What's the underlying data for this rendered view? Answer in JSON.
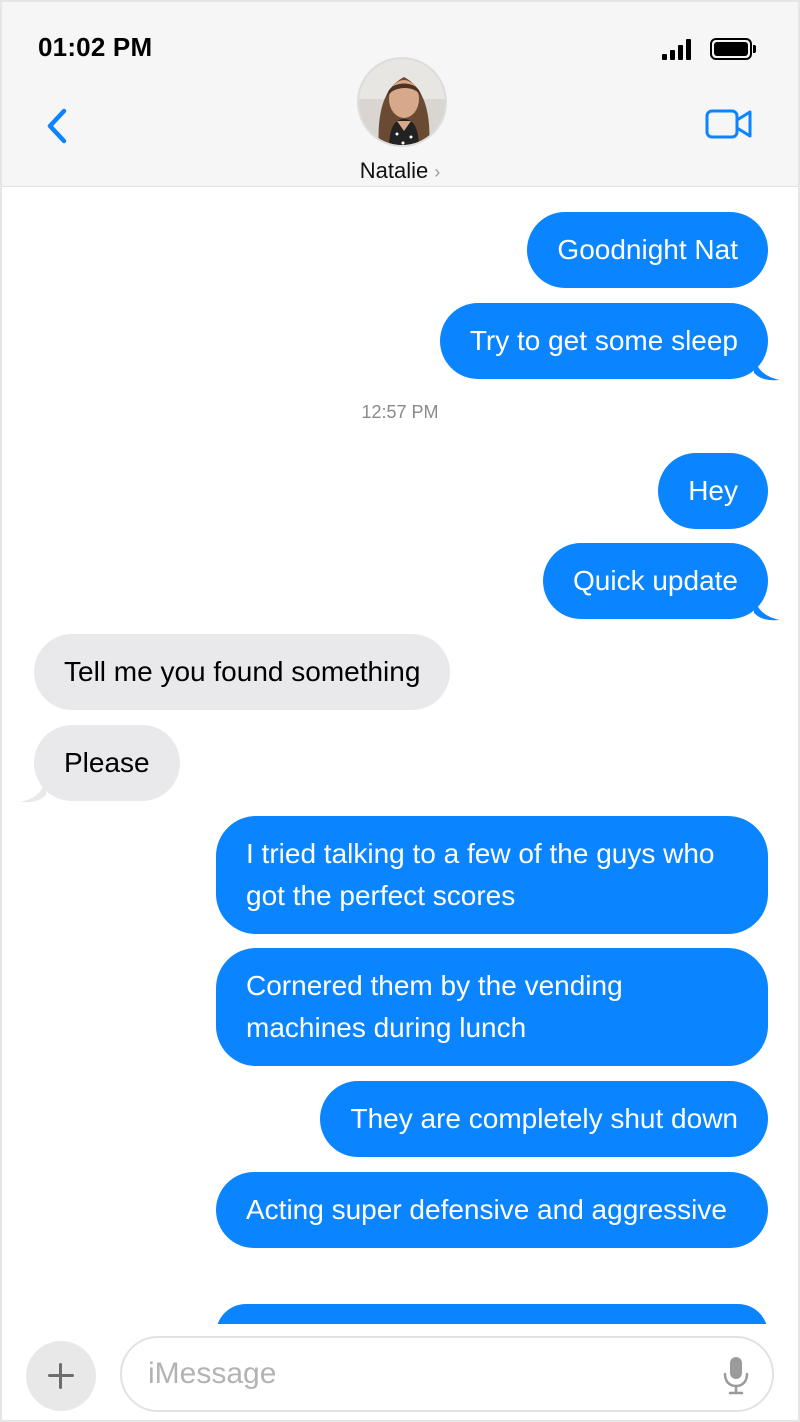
{
  "status_bar": {
    "time": "01:02 PM"
  },
  "header": {
    "contact_name": "Natalie",
    "chevron": "›",
    "back_icon": "chevron-left-icon",
    "video_icon": "video-camera-icon",
    "accent_color": "#0a84ff"
  },
  "thread": {
    "messages": [
      {
        "direction": "out",
        "text": "Goodnight Nat"
      },
      {
        "direction": "out",
        "text": "Try to get some sleep"
      },
      {
        "type": "timestamp",
        "text": "12:57 PM"
      },
      {
        "direction": "out",
        "text": "Hey"
      },
      {
        "direction": "out",
        "text": "Quick update"
      },
      {
        "direction": "in",
        "text": "Tell me you found something"
      },
      {
        "direction": "in",
        "text": "Please"
      },
      {
        "direction": "out",
        "text": "I tried talking to a few of the guys who got the perfect scores"
      },
      {
        "direction": "out",
        "text": "Cornered them by the vending machines during lunch"
      },
      {
        "direction": "out",
        "text": "They are completely shut down"
      },
      {
        "direction": "out",
        "text": "Acting super defensive and aggressive"
      }
    ],
    "outgoing_color": "#0a84ff",
    "incoming_color": "#e9e9eb"
  },
  "composer": {
    "placeholder": "iMessage",
    "value": "",
    "plus_icon": "plus-icon",
    "mic_icon": "microphone-icon"
  }
}
